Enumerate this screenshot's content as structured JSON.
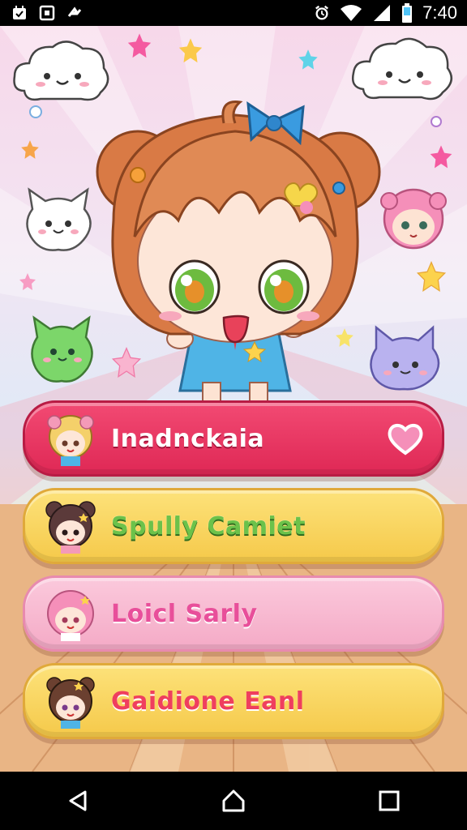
{
  "status_bar": {
    "time": "7:40",
    "left_icons": [
      "calendar-icon",
      "screenshot-icon",
      "cast-icon"
    ],
    "right_icons": [
      "alarm-icon",
      "wifi-icon",
      "signal-icon",
      "battery-icon"
    ]
  },
  "menu": {
    "items": [
      {
        "label": "Inadnckaia",
        "avatar": "blonde-girl-avatar",
        "favorite": true
      },
      {
        "label": "Spully Camiet",
        "avatar": "brown-bun-girl-avatar"
      },
      {
        "label": "Loicl Sarly",
        "avatar": "pink-hair-girl-avatar"
      },
      {
        "label": "Gaidione Eanl",
        "avatar": "brown-hair-girl-avatar"
      }
    ]
  },
  "navigation": {
    "buttons": [
      "back-icon",
      "home-icon",
      "recents-icon"
    ]
  },
  "colors": {
    "card1": "#e8335f",
    "card2": "#f7d35e",
    "card3": "#f6b6cf",
    "card4": "#f7d35e"
  }
}
